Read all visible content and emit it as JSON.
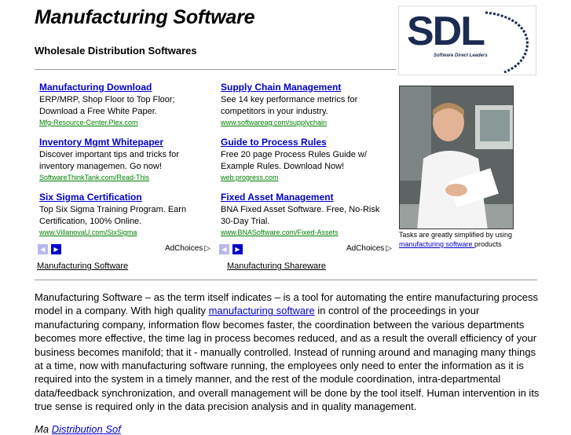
{
  "header": {
    "title": "Manufacturing Software",
    "subtitle": "Wholesale Distribution Softwares"
  },
  "logo": {
    "letters": "SDL",
    "tagline": "Software Direct Leaders"
  },
  "ads_left": [
    {
      "title": "Manufacturing Download",
      "desc": "ERP/MRP, Shop Floor to Top Floor; Download a Free White Paper.",
      "url": "Mfg-Resource-Center.Plex.com"
    },
    {
      "title": "Inventory Mgmt Whitepaper",
      "desc": "Discover important tips and tricks for inventory managemen. Go now!",
      "url": "SoftwareThinkTank.com/Read-This"
    },
    {
      "title": "Six Sigma Certification",
      "desc": "Top Six Sigma Training Program. Earn Certification, 100% Online.",
      "url": "www.VillanovaU.com/SixSigma"
    }
  ],
  "ads_right": [
    {
      "title": "Supply Chain Management",
      "desc": "See 14 key performance metrics for competitors in your industry.",
      "url": "www.softwareag.com/supplychain"
    },
    {
      "title": "Guide to Process Rules",
      "desc": "Free 20 page Process Rules Guide w/ Example Rules. Download Now!",
      "url": "web.progress.com"
    },
    {
      "title": "Fixed Asset Management",
      "desc": "BNA Fixed Asset Software. Free, No-Risk 30-Day Trial.",
      "url": "www.BNASoftware.com/Fixed-Assets"
    }
  ],
  "ad_nav": {
    "prev_icon": "arrow-left-icon",
    "next_icon": "arrow-right-icon",
    "adchoices_label": "AdChoices"
  },
  "footer_links": {
    "left": "Manufacturing Software",
    "right": "Manufacturing Shareware"
  },
  "photo_caption": {
    "before": "Tasks are greatly simplified by using ",
    "link": "manufacturing software ",
    "after": "products"
  },
  "article": {
    "part1": "Manufacturing Software – as the term itself indicates – is a tool for automating the entire manufacturing process model in a company. With high quality ",
    "link": "manufacturing software",
    "part2": " in control of the proceedings in your manufacturing company, information flow becomes faster, the coordination between the various departments becomes more effective, the time lag in process becomes reduced, and as a result the overall efficiency of your business becomes manifold; that it - manually controlled. Instead of running around and managing many things at a time, now with manufacturing software running, the employees only need to enter the information as it is required into the system in a timely manner, and the rest of the module coordination, intra-departmental data/feedback synchronization, and overall management will be done by the tool itself. Human intervention in its true sense is required only in the data precision analysis and in quality management."
  },
  "next_heading": {
    "prefix": "Ma",
    "link": "Distribution Sof"
  },
  "colors": {
    "link": "#0000cc",
    "ad_url": "#008000",
    "logo": "#1c2b52"
  }
}
